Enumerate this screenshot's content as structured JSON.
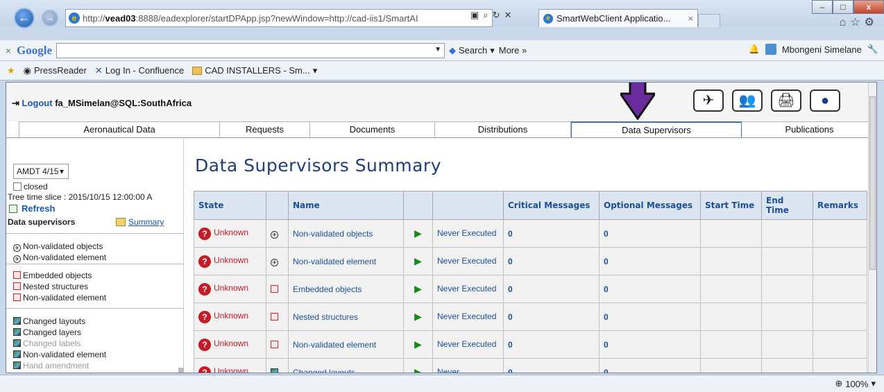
{
  "browser": {
    "address_prefix": "http://",
    "address_host": "vead03",
    "address_rest": ":8888/eadexplorer/startDPApp.jsp?newWindow=http://cad-iis1/SmartAI",
    "tab_title": "SmartWebClient Applicatio...",
    "tab_close": "×",
    "google_label": "Google",
    "search_label": "Search",
    "more_label": "More »",
    "user_name": "Mbongeni Simelane",
    "favorites": [
      "PressReader",
      "Log In - Confluence",
      "CAD INSTALLERS - Sm..."
    ],
    "zoom": "100%"
  },
  "header": {
    "logout_label": "Logout",
    "user": "fa_MSimelan@SQL:SouthAfrica"
  },
  "tabs": [
    {
      "label": "Aeronautical Data",
      "active": false
    },
    {
      "label": "Requests",
      "active": false
    },
    {
      "label": "Documents",
      "active": false
    },
    {
      "label": "Distributions",
      "active": false
    },
    {
      "label": "Data Supervisors",
      "active": true
    },
    {
      "label": "Publications",
      "active": false
    }
  ],
  "sidebar": {
    "amdt_value": "AMDT 4/15",
    "closed_label": "closed",
    "tree_time_slice": "Tree time slice : 2015/10/15 12:00:00 A",
    "refresh_label": "Refresh",
    "data_supervisors_label": "Data supervisors",
    "summary_label": "Summary",
    "group1": [
      "Non-validated objects",
      "Non-validated element"
    ],
    "group2": [
      "Embedded objects",
      "Nested structures",
      "Non-validated element"
    ],
    "group3": [
      {
        "label": "Changed layouts",
        "dim": false
      },
      {
        "label": "Changed layers",
        "dim": false
      },
      {
        "label": "Changed labels",
        "dim": true
      },
      {
        "label": "Non-validated element",
        "dim": false
      },
      {
        "label": "Hand amendment",
        "dim": true
      }
    ]
  },
  "main": {
    "title": "Data Supervisors Summary",
    "columns": [
      "State",
      "",
      "Name",
      "",
      "",
      "Critical Messages",
      "Optional Messages",
      "Start Time",
      "End Time",
      "Remarks"
    ],
    "rows": [
      {
        "state": "Unknown",
        "icon": "plane",
        "name": "Non-validated objects",
        "exec": "Never Executed",
        "critical": "0",
        "optional": "0"
      },
      {
        "state": "Unknown",
        "icon": "plane",
        "name": "Non-validated element",
        "exec": "Never Executed",
        "critical": "0",
        "optional": "0"
      },
      {
        "state": "Unknown",
        "icon": "doc",
        "name": "Embedded objects",
        "exec": "Never Executed",
        "critical": "0",
        "optional": "0"
      },
      {
        "state": "Unknown",
        "icon": "doc",
        "name": "Nested structures",
        "exec": "Never Executed",
        "critical": "0",
        "optional": "0"
      },
      {
        "state": "Unknown",
        "icon": "doc",
        "name": "Non-validated element",
        "exec": "Never Executed",
        "critical": "0",
        "optional": "0"
      },
      {
        "state": "Unknown",
        "icon": "map",
        "name": "Changed layouts",
        "exec": "Never",
        "critical": "0",
        "optional": "0"
      }
    ]
  }
}
